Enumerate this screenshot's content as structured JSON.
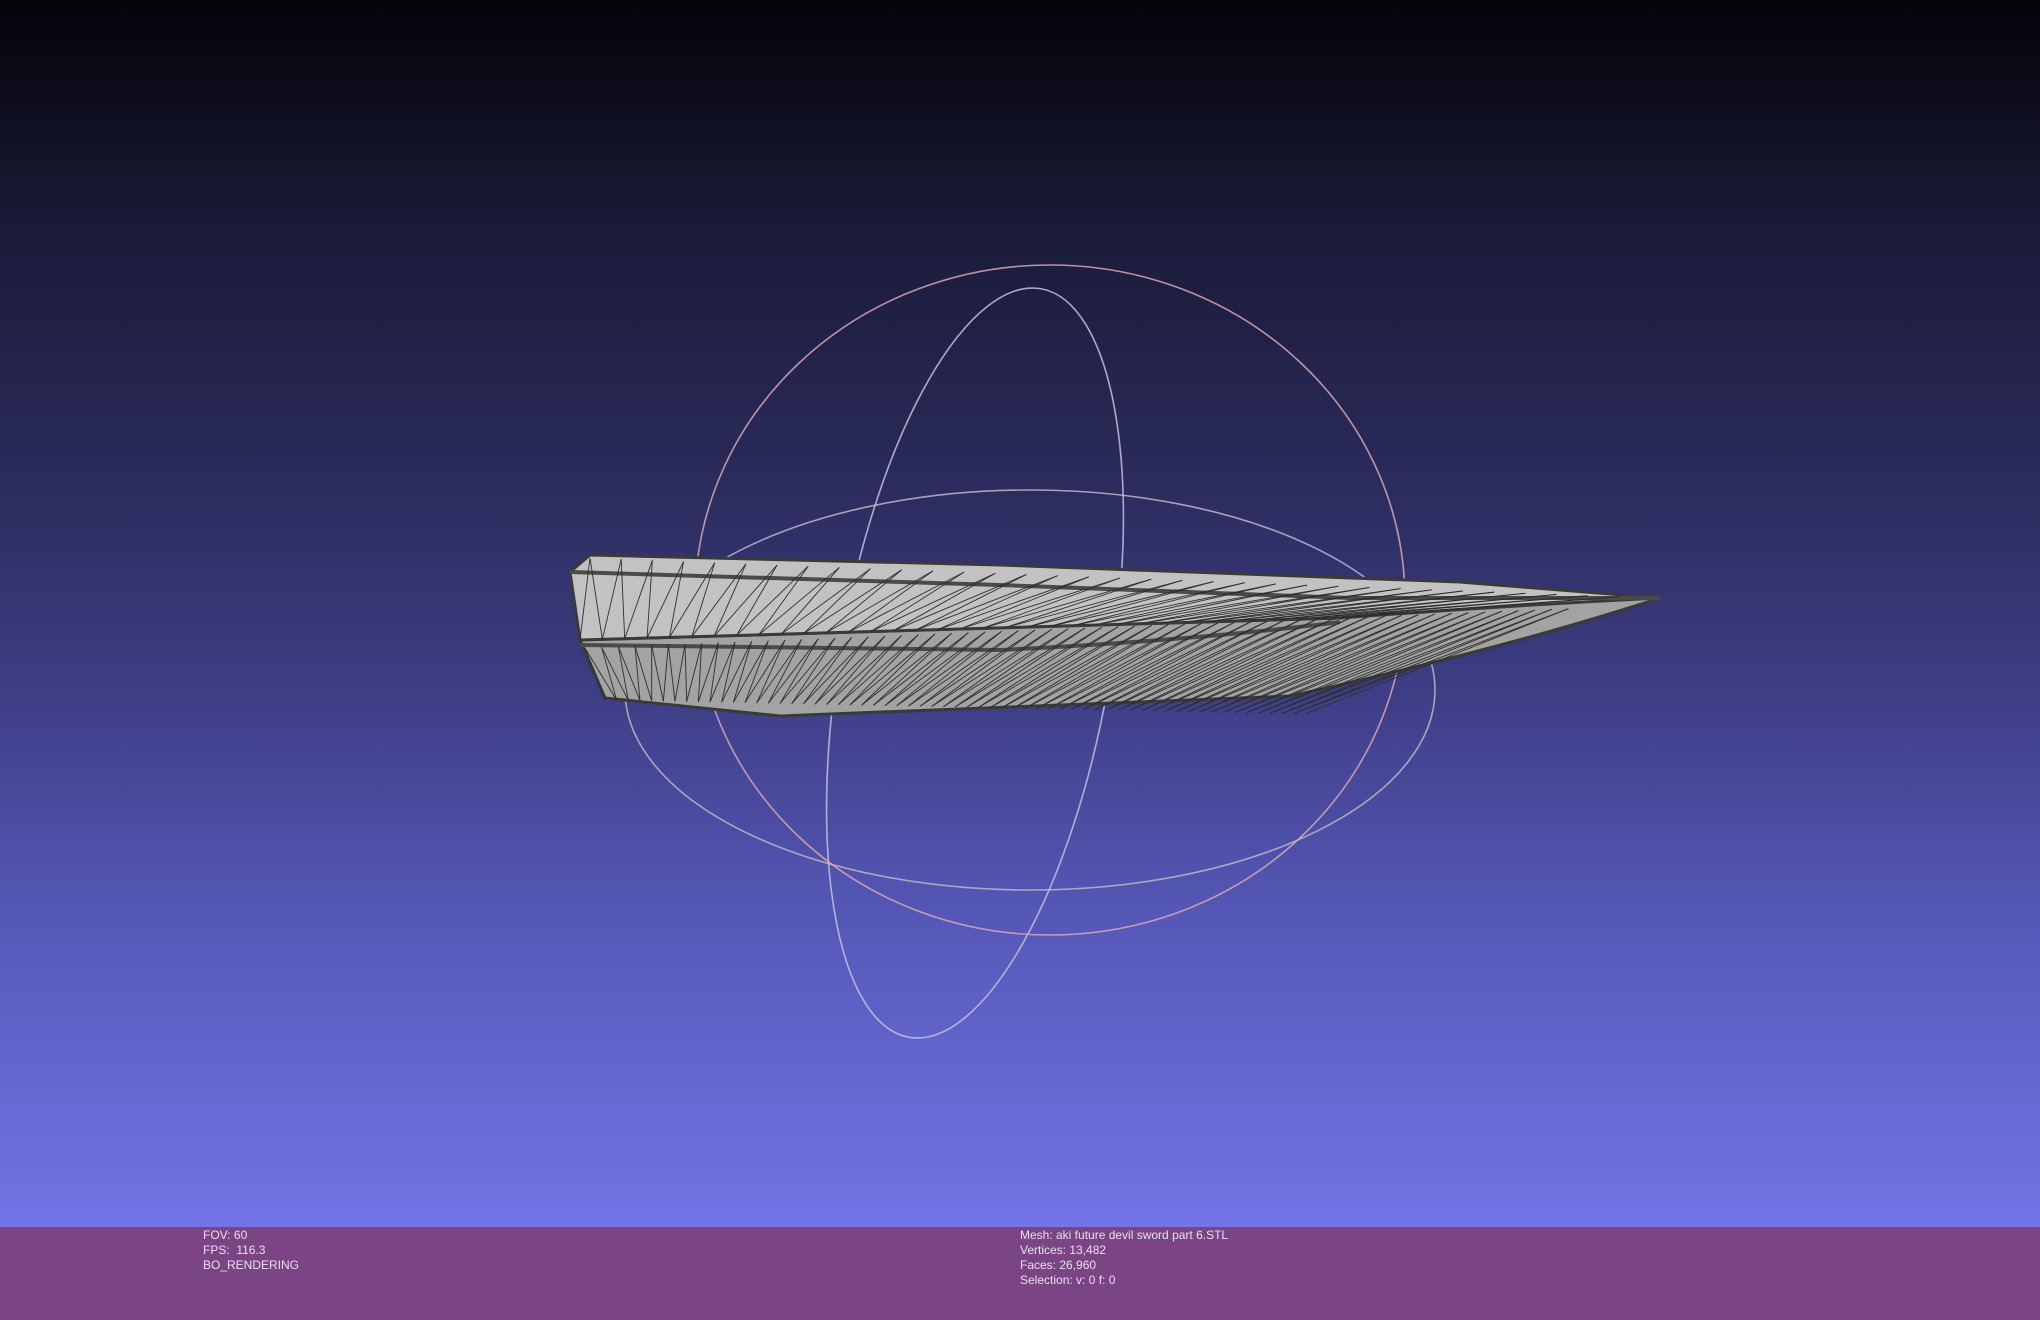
{
  "window": {
    "background_top": "#030308",
    "background_bottom": "#7374e6",
    "status_bar_color": "#7b4585"
  },
  "viewport": {
    "trackball_icon": "trackball-icon",
    "model_name": "mesh-model"
  },
  "info_left": {
    "fov": "FOV: 60",
    "fps": "FPS:  116.3",
    "mode": "BO_RENDERING"
  },
  "info_right": {
    "mesh": "Mesh: aki future devil sword part 6.STL",
    "vertices": "Vertices: 13,482",
    "faces": "Faces: 26,960",
    "selection": "Selection: v: 0 f: 0"
  }
}
